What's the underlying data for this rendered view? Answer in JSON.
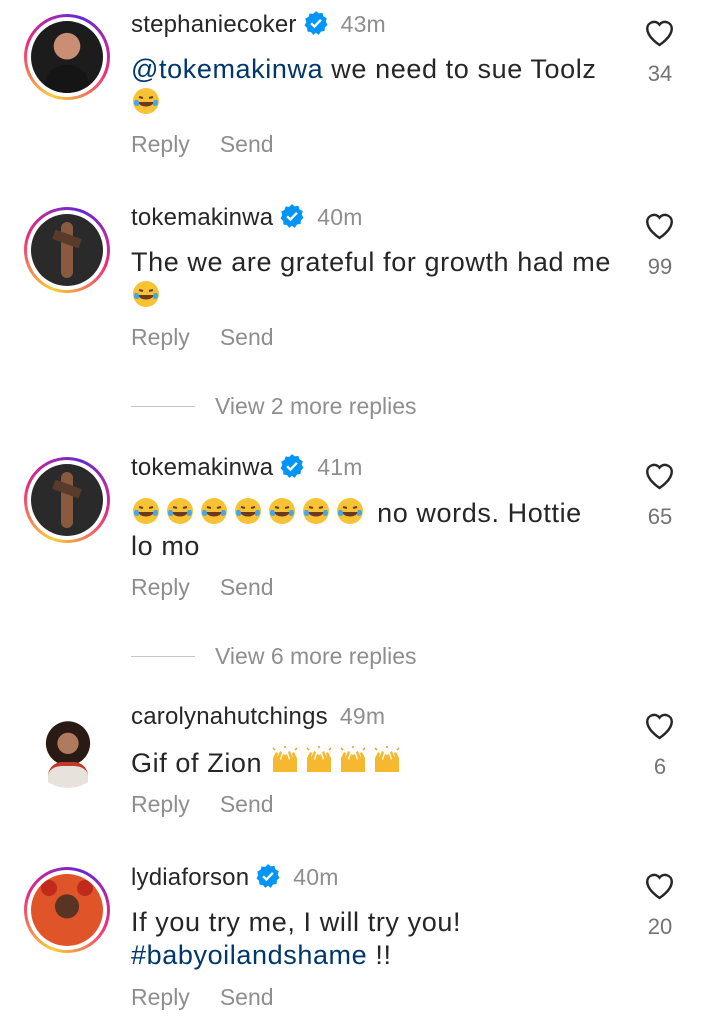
{
  "actions": {
    "reply": "Reply",
    "send": "Send"
  },
  "comments": [
    {
      "username": "stephaniecoker",
      "verified": true,
      "time": "43m",
      "mention": "@tokemakinwa",
      "text_line1": " we need to sue Toolz",
      "emoji_count": 1,
      "likes": "34"
    },
    {
      "username": "tokemakinwa",
      "verified": true,
      "time": "40m",
      "text_line1": "The we are grateful for growth had me",
      "emoji_count": 1,
      "likes": "99"
    },
    {
      "username": "tokemakinwa",
      "verified": true,
      "time": "41m",
      "text_after_emoji": " no words. Hottie",
      "text_line2": "lo mo",
      "emoji_count": 7,
      "likes": "65"
    },
    {
      "username": "carolynahutchings",
      "verified": false,
      "time": "49m",
      "text_line1": "Gif of Zion ",
      "emoji_count": 4,
      "likes": "6"
    },
    {
      "username": "lydiaforson",
      "verified": true,
      "time": "40m",
      "text_line1": "If you try me, I will try you!",
      "hashtag": "#babyoilandshame",
      "text_after_hashtag": " !!",
      "likes": "20"
    }
  ],
  "view_more": [
    "View 2 more replies",
    "View 6 more replies"
  ],
  "icons": {
    "heart": "heart-outline-icon",
    "verified": "verified-badge-icon",
    "laugh": "face-with-tears-of-joy",
    "raised-hands": "raising-hands"
  },
  "colors": {
    "verified": "#0095f6",
    "mention": "#00376b",
    "secondary": "#8e8e8e"
  }
}
